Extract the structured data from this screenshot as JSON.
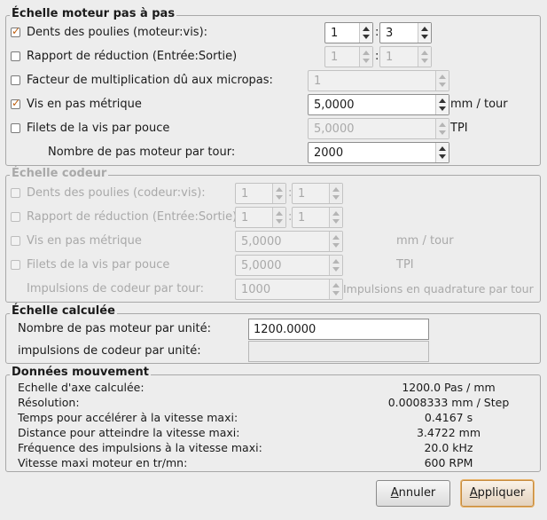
{
  "motor_scale": {
    "title": "Échelle moteur pas à pas",
    "pulley_teeth": {
      "label": "Dents des poulies (moteur:vis):",
      "checked": true,
      "a": "1",
      "b": "3"
    },
    "reduction": {
      "label": "Rapport de réduction (Entrée:Sortie)",
      "checked": false,
      "a": "1",
      "b": "1"
    },
    "microstep": {
      "label": "Facteur de multiplication dû aux micropas:",
      "checked": false,
      "value": "1"
    },
    "metric_screw": {
      "label": "Vis en pas métrique",
      "checked": true,
      "value": "5,0000",
      "unit": "mm / tour"
    },
    "tpi_screw": {
      "label": "Filets de la vis par pouce",
      "checked": false,
      "value": "5,0000",
      "unit": "TPI"
    },
    "steps_per_rev": {
      "label": "Nombre de pas moteur par tour:",
      "value": "2000"
    }
  },
  "encoder_scale": {
    "title": "Échelle codeur",
    "pulley_teeth": {
      "label": "Dents des poulies (codeur:vis):",
      "a": "1",
      "b": "1"
    },
    "reduction": {
      "label": "Rapport de réduction (Entrée:Sortie)",
      "a": "1",
      "b": "1"
    },
    "metric_screw": {
      "label": "Vis en pas métrique",
      "value": "5,0000",
      "unit": "mm / tour"
    },
    "tpi_screw": {
      "label": "Filets de la vis par pouce",
      "value": "5,0000",
      "unit": "TPI"
    },
    "pulses_per_rev": {
      "label": "Impulsions de codeur par tour:",
      "value": "1000",
      "unit": "Impulsions en quadrature par tour"
    }
  },
  "computed_scale": {
    "title": "Échelle calculée",
    "steps_per_unit": {
      "label": "Nombre de pas moteur par unité:",
      "value": "1200.0000"
    },
    "encoder_per_unit": {
      "label": "impulsions de codeur par unité:",
      "value": ""
    }
  },
  "motion_data": {
    "title": "Données mouvement",
    "rows": [
      {
        "label": "Echelle d'axe calculée:",
        "value": "1200.0 Pas / mm"
      },
      {
        "label": "Résolution:",
        "value": "0.0008333 mm / Step"
      },
      {
        "label": "Temps pour accélérer à la vitesse maxi:",
        "value": "0.4167 s"
      },
      {
        "label": "Distance pour atteindre la vitesse maxi:",
        "value": "3.4722 mm"
      },
      {
        "label": "Fréquence des impulsions à la vitesse maxi:",
        "value": "20.0 kHz"
      },
      {
        "label": "Vitesse maxi moteur en tr/mn:",
        "value": "600 RPM"
      }
    ]
  },
  "buttons": {
    "cancel_first": "A",
    "cancel_rest": "nnuler",
    "apply_first": "A",
    "apply_rest": "ppliquer"
  }
}
